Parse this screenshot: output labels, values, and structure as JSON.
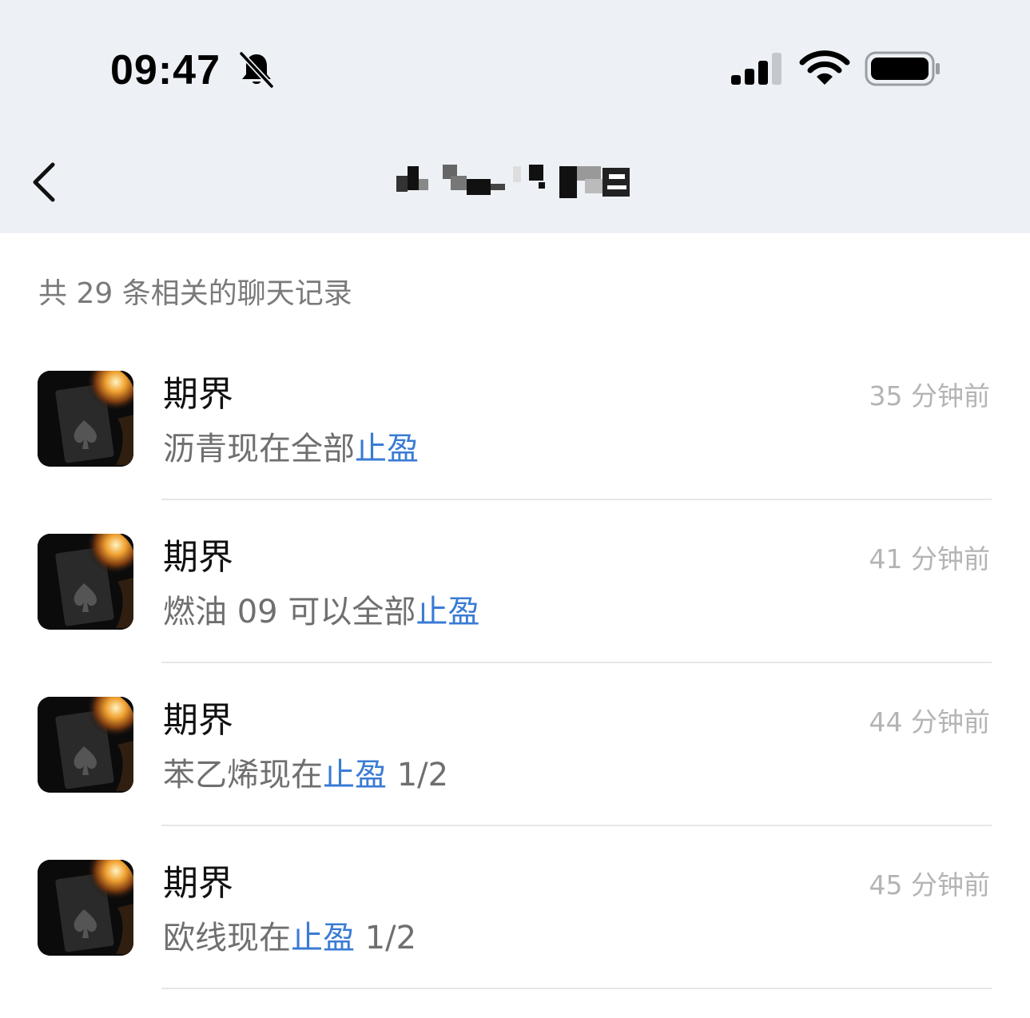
{
  "status_bar": {
    "time": "09:47",
    "icons": [
      "bell-slash-icon",
      "cellular-signal-icon",
      "wifi-icon",
      "battery-icon"
    ]
  },
  "nav": {
    "back_icon": "chevron-left-icon",
    "title_redacted": true
  },
  "search": {
    "result_count": "共 29 条相关的聊天记录"
  },
  "colors": {
    "header_bg": "#edf1f5",
    "highlight": "#3a7bd5",
    "secondary_text": "#6f6f6f",
    "time_text": "#b4b4b4"
  },
  "results": [
    {
      "sender": "期界",
      "time": "35 分钟前",
      "before": "沥青现在全部",
      "highlight": "止盈",
      "after": ""
    },
    {
      "sender": "期界",
      "time": "41 分钟前",
      "before": "燃油 09 可以全部",
      "highlight": "止盈",
      "after": ""
    },
    {
      "sender": "期界",
      "time": "44 分钟前",
      "before": "苯乙烯现在",
      "highlight": "止盈",
      "after": " 1/2"
    },
    {
      "sender": "期界",
      "time": "45 分钟前",
      "before": "欧线现在",
      "highlight": "止盈",
      "after": " 1/2"
    }
  ]
}
